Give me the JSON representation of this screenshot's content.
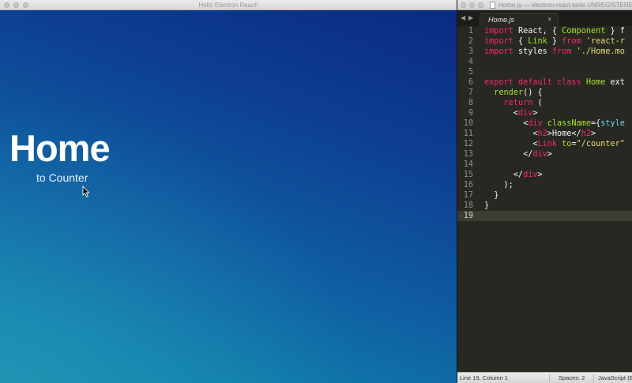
{
  "electron": {
    "window_title": "Hello Electron React!",
    "heading": "Home",
    "link_text": "to Counter",
    "colors": {
      "gradient_top": "#0b2a82",
      "gradient_bottom": "#118aa9"
    }
  },
  "editor": {
    "window_title": "Home.js — electron-react-boile",
    "unregistered": "UNREGISTERE",
    "nav_back": "◀",
    "nav_forward": "▶",
    "tab": {
      "label": "Home.js",
      "close": "×"
    },
    "lines": [
      {
        "n": "1",
        "tokens": [
          [
            "kw",
            "import"
          ],
          [
            "tok",
            " React, { "
          ],
          [
            "cls",
            "Component"
          ],
          [
            "tok",
            " } f"
          ]
        ]
      },
      {
        "n": "2",
        "tokens": [
          [
            "kw",
            "import"
          ],
          [
            "tok",
            " { "
          ],
          [
            "cls",
            "Link"
          ],
          [
            "tok",
            " } "
          ],
          [
            "kw",
            "from"
          ],
          [
            "tok",
            " "
          ],
          [
            "str",
            "'react-r"
          ]
        ]
      },
      {
        "n": "3",
        "tokens": [
          [
            "kw",
            "import"
          ],
          [
            "tok",
            " styles "
          ],
          [
            "kw",
            "from"
          ],
          [
            "tok",
            " "
          ],
          [
            "str",
            "'./Home.mo"
          ]
        ]
      },
      {
        "n": "4",
        "tokens": []
      },
      {
        "n": "5",
        "tokens": []
      },
      {
        "n": "6",
        "tokens": [
          [
            "kw",
            "export"
          ],
          [
            "tok",
            " "
          ],
          [
            "kw",
            "default"
          ],
          [
            "tok",
            " "
          ],
          [
            "kw",
            "class"
          ],
          [
            "tok",
            " "
          ],
          [
            "cls",
            "Home"
          ],
          [
            "tok",
            " ext"
          ]
        ]
      },
      {
        "n": "7",
        "tokens": [
          [
            "tok",
            "  "
          ],
          [
            "cls",
            "render"
          ],
          [
            "tok",
            "() {"
          ]
        ]
      },
      {
        "n": "8",
        "tokens": [
          [
            "tok",
            "    "
          ],
          [
            "kw",
            "return"
          ],
          [
            "tok",
            " ("
          ]
        ]
      },
      {
        "n": "9",
        "tokens": [
          [
            "tok",
            "      <"
          ],
          [
            "tag",
            "div"
          ],
          [
            "tok",
            ">"
          ]
        ]
      },
      {
        "n": "10",
        "tokens": [
          [
            "tok",
            "        <"
          ],
          [
            "tag",
            "div"
          ],
          [
            "tok",
            " "
          ],
          [
            "attr",
            "className"
          ],
          [
            "tok",
            "={"
          ],
          [
            "fn",
            "style"
          ]
        ]
      },
      {
        "n": "11",
        "tokens": [
          [
            "tok",
            "          <"
          ],
          [
            "tag",
            "h2"
          ],
          [
            "tok",
            ">Home</"
          ],
          [
            "tag",
            "h2"
          ],
          [
            "tok",
            ">"
          ]
        ]
      },
      {
        "n": "12",
        "tokens": [
          [
            "tok",
            "          <"
          ],
          [
            "tag",
            "Link"
          ],
          [
            "tok",
            " "
          ],
          [
            "attr",
            "to"
          ],
          [
            "tok",
            "="
          ],
          [
            "str",
            "\"/counter\""
          ]
        ]
      },
      {
        "n": "13",
        "tokens": [
          [
            "tok",
            "        </"
          ],
          [
            "tag",
            "div"
          ],
          [
            "tok",
            ">"
          ]
        ]
      },
      {
        "n": "14",
        "tokens": []
      },
      {
        "n": "15",
        "tokens": [
          [
            "tok",
            "      </"
          ],
          [
            "tag",
            "div"
          ],
          [
            "tok",
            ">"
          ]
        ]
      },
      {
        "n": "16",
        "tokens": [
          [
            "tok",
            "    );"
          ]
        ]
      },
      {
        "n": "17",
        "tokens": [
          [
            "tok",
            "  }"
          ]
        ]
      },
      {
        "n": "18",
        "tokens": [
          [
            "tok",
            "}"
          ]
        ]
      },
      {
        "n": "19",
        "tokens": [],
        "current": true
      }
    ],
    "status": {
      "cursor": "Line 19, Column 1",
      "spaces": "Spaces: 2",
      "syntax": "JavaScript (B"
    },
    "colors": {
      "background": "#272822",
      "keyword": "#f92672",
      "class": "#a6e22e",
      "string": "#e6db74"
    }
  }
}
